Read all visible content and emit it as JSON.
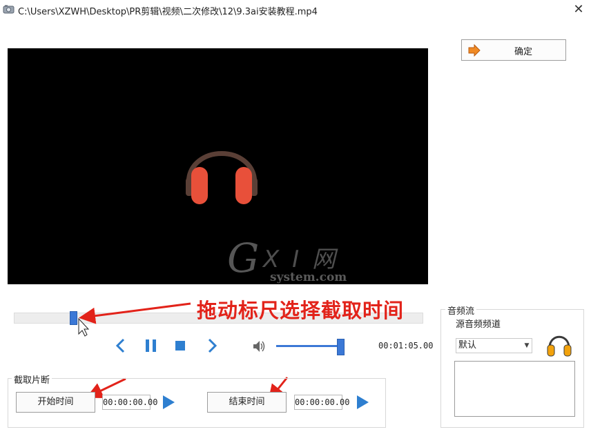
{
  "window": {
    "title": "C:\\Users\\XZWH\\Desktop\\PR剪辑\\视频\\二次修改\\12\\9.3ai安装教程.mp4",
    "close_glyph": "✕"
  },
  "video": {
    "watermark_g": "G",
    "watermark_xi": "X I 网",
    "watermark_site": "system.com"
  },
  "ok_button": {
    "label": "确定",
    "icon": "arrow-right-icon"
  },
  "seek": {
    "position_fraction": 0.145
  },
  "annotation": {
    "text": "拖动标尺选择截取时间",
    "color": "#e2231a"
  },
  "playback": {
    "time": "00:01:05.00",
    "volume_fraction": 1.0,
    "icons": [
      "chevron-left-icon",
      "pause-icon",
      "stop-icon",
      "chevron-right-icon",
      "speaker-icon"
    ]
  },
  "clip_group": {
    "legend": "截取片断",
    "start_button": "开始时间",
    "start_time": "00:00:00.00",
    "end_button": "结束时间",
    "end_time": "00:00:00.00"
  },
  "audio_group": {
    "legend": "音频流",
    "source_label": "源音频频道",
    "selected": "默认"
  },
  "colors": {
    "accent": "#3b78d6",
    "headphone_red": "#e8503a",
    "annotation_red": "#e2231a"
  }
}
